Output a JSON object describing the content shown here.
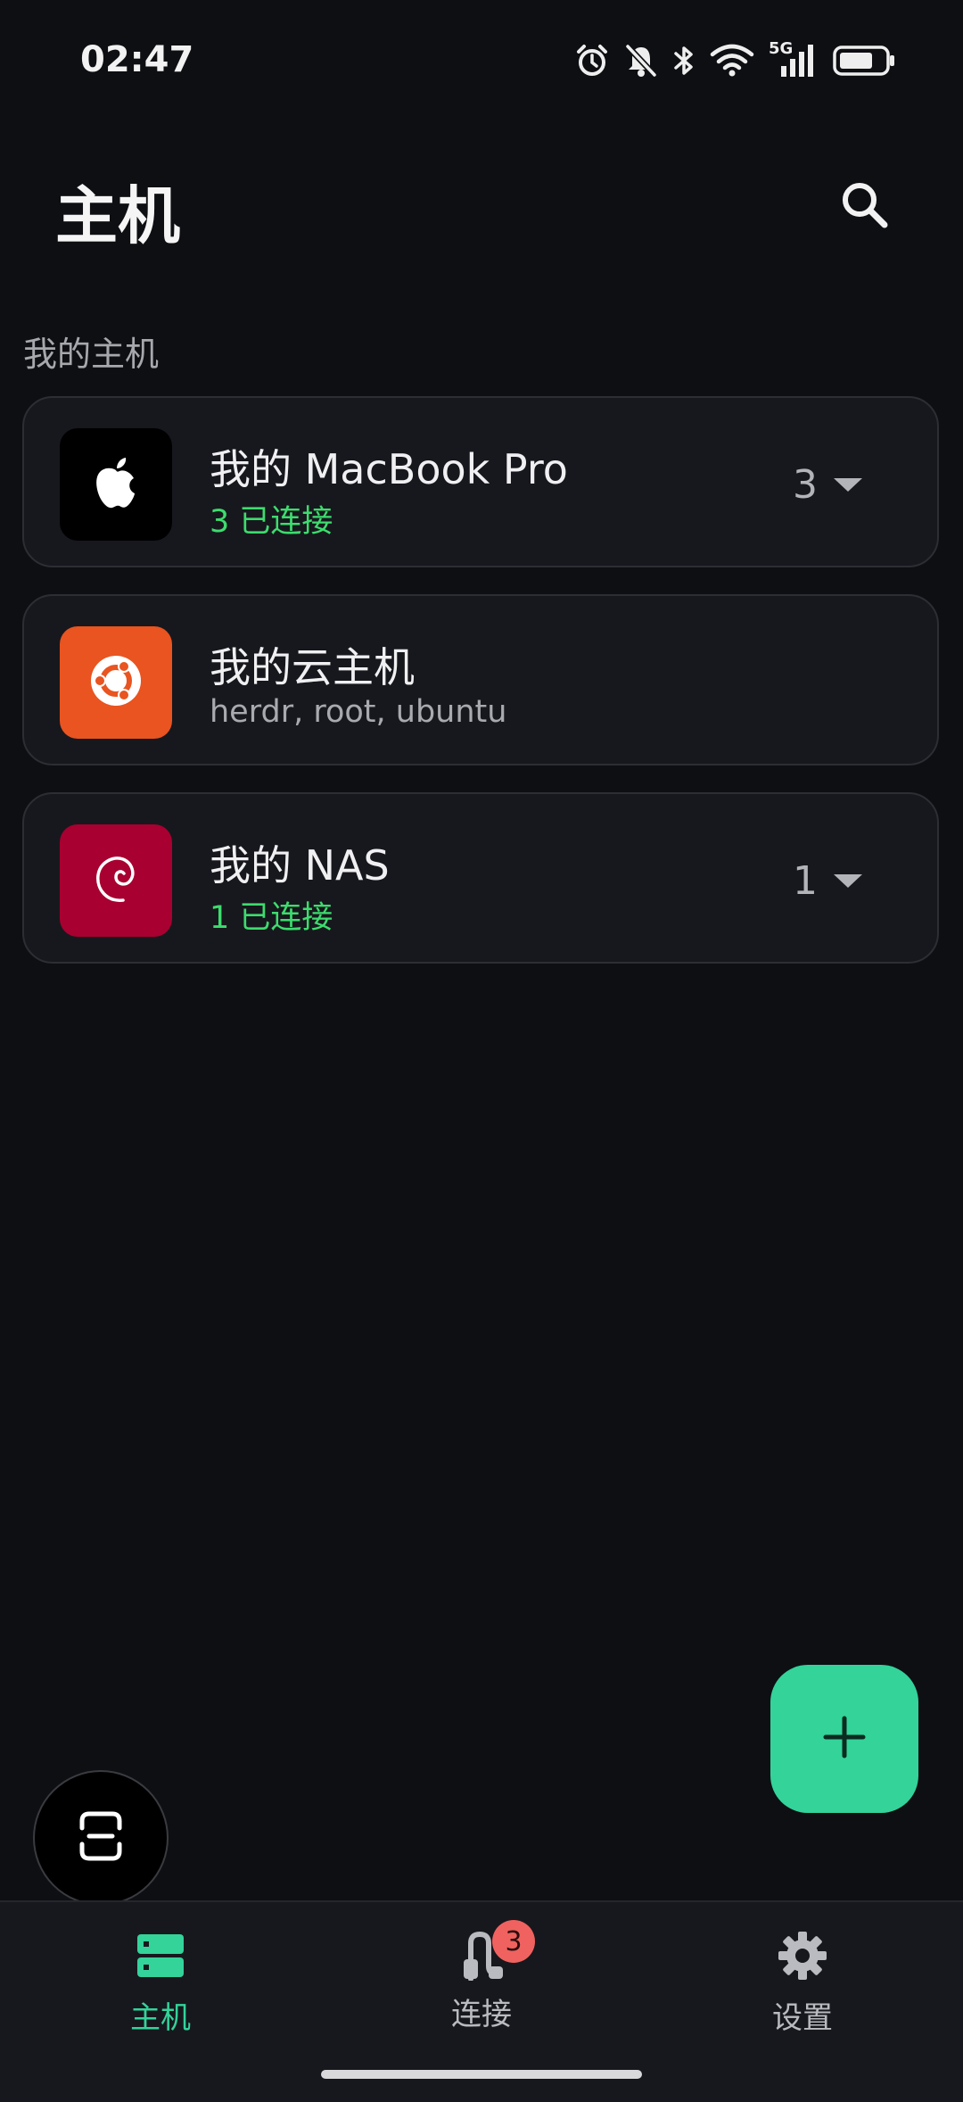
{
  "status_bar": {
    "time": "02:47",
    "icons": [
      "alarm-icon",
      "mute-bell-icon",
      "bluetooth-icon",
      "wifi-icon",
      "5g-signal-icon",
      "battery-icon"
    ],
    "network_label": "5G"
  },
  "header": {
    "title": "主机",
    "search_icon": "search-icon"
  },
  "section": {
    "label": "我的主机"
  },
  "hosts": [
    {
      "name": "我的 MacBook Pro",
      "subtitle": "3 已连接",
      "subtitle_color": "#3ddc6e",
      "count": "3",
      "icon": "apple-icon",
      "icon_bg": "#000000"
    },
    {
      "name": "我的云主机",
      "subtitle": "herdr, root, ubuntu",
      "subtitle_color": "#a8aab0",
      "count": "",
      "icon": "ubuntu-icon",
      "icon_bg": "#e95420"
    },
    {
      "name": "我的 NAS",
      "subtitle": "1 已连接",
      "subtitle_color": "#3ddc6e",
      "count": "1",
      "icon": "debian-icon",
      "icon_bg": "#a80030"
    }
  ],
  "fab": {
    "icon": "plus-icon",
    "color": "#33d39a"
  },
  "floating_button": {
    "icon": "floating-window-icon"
  },
  "bottom_nav": {
    "items": [
      {
        "label": "主机",
        "icon": "server-icon",
        "active": true
      },
      {
        "label": "连接",
        "icon": "connection-icon",
        "active": false,
        "badge": "3"
      },
      {
        "label": "设置",
        "icon": "gear-icon",
        "active": false
      }
    ]
  },
  "colors": {
    "background": "#0e0f13",
    "card": "#17181d",
    "accent": "#33d39a",
    "badge": "#f0625f"
  }
}
